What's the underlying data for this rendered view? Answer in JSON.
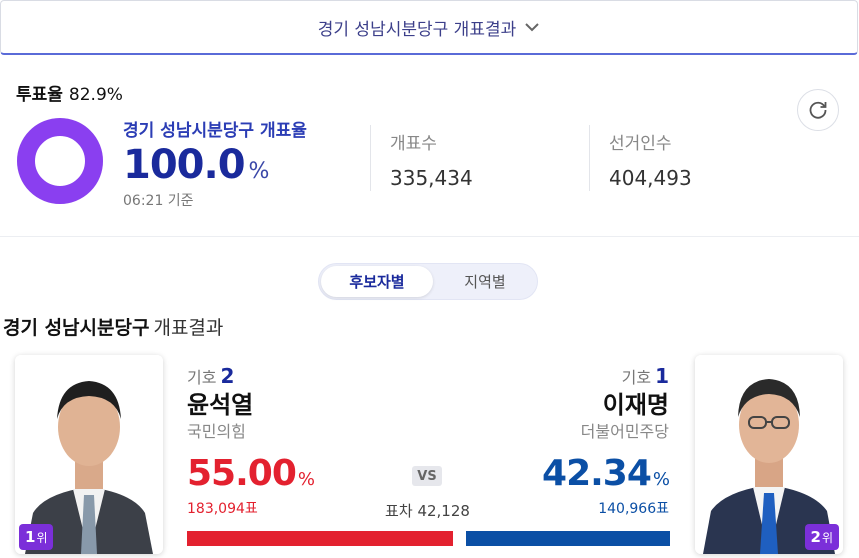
{
  "header": {
    "title": "경기 성남시분당구 개표결과",
    "chevron_icon": "chevron-down-icon"
  },
  "turnout": {
    "label": "투표율",
    "value": "82.9%"
  },
  "count": {
    "title": "경기 성남시분당구 개표율",
    "rate": "100.0",
    "unit": "%",
    "progress_percent": 100,
    "time": "06:21 기준",
    "counted_label": "개표수",
    "counted_value": "335,434",
    "electors_label": "선거인수",
    "electors_value": "404,493"
  },
  "refresh_icon": "refresh-icon",
  "toggle": {
    "candidate": "후보자별",
    "region": "지역별"
  },
  "section": {
    "region": "경기 성남시분당구",
    "rest": "개표결과"
  },
  "candidates": {
    "left": {
      "rank": "1",
      "rank_suffix": "위",
      "number_label": "기호",
      "number": "2",
      "name": "윤석열",
      "party": "국민의힘",
      "rate": "55.00",
      "pct": "%",
      "votes": "183,094표",
      "color": "#e3212f"
    },
    "right": {
      "rank": "2",
      "rank_suffix": "위",
      "number_label": "기호",
      "number": "1",
      "name": "이재명",
      "party": "더불어민주당",
      "rate": "42.34",
      "pct": "%",
      "votes": "140,966표",
      "color": "#0b4fa5"
    }
  },
  "vs": "VS",
  "diff": {
    "label": "표차",
    "value": "42,128"
  },
  "colors": {
    "accent": "#1a2a9c",
    "donut": "#8a3ff0",
    "rank_badge": "#7b2fd9",
    "left_bar": "#e3212f",
    "right_bar": "#0b4fa5"
  }
}
